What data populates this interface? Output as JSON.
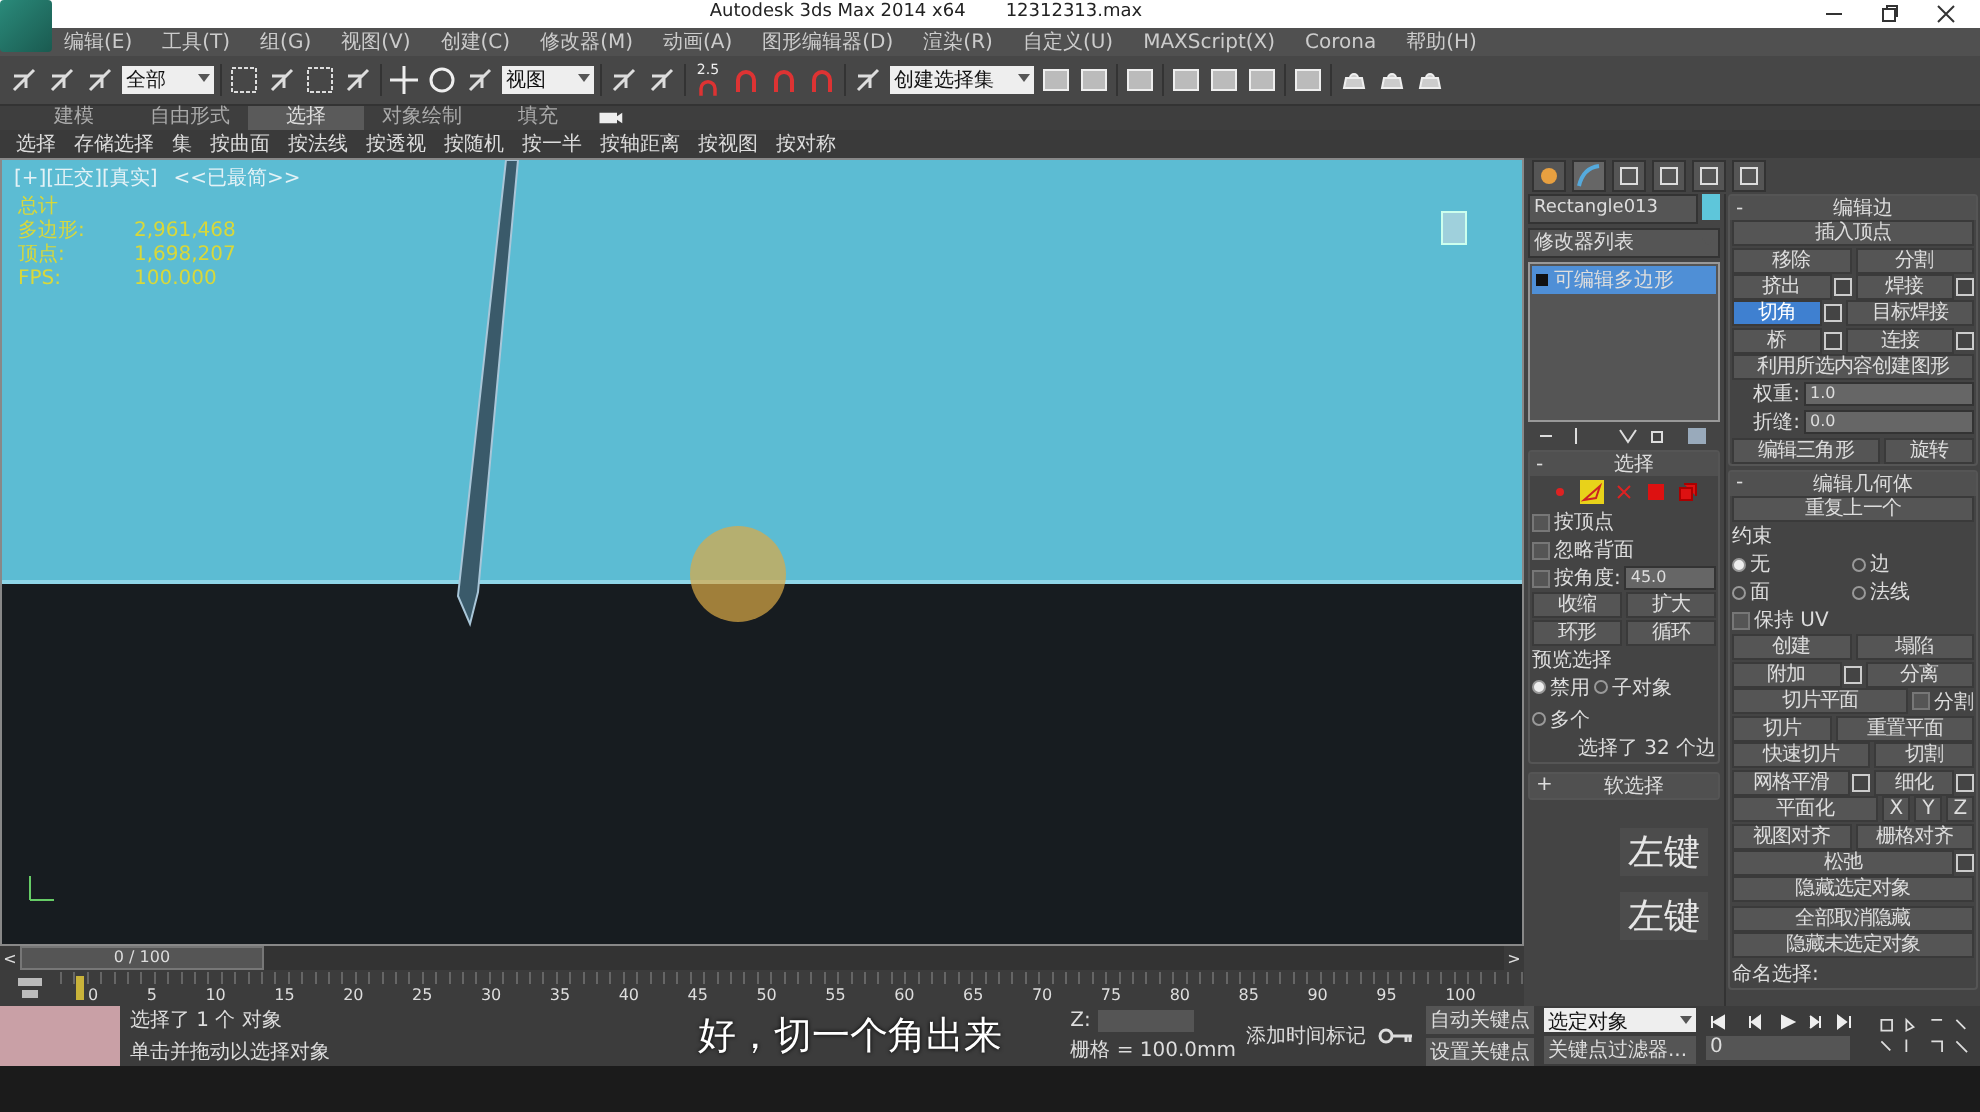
{
  "title_bar": {
    "app": "Autodesk 3ds Max  2014 x64",
    "file": "12312313.max"
  },
  "menu": [
    "编辑(E)",
    "工具(T)",
    "组(G)",
    "视图(V)",
    "创建(C)",
    "修改器(M)",
    "动画(A)",
    "图形编辑器(D)",
    "渲染(R)",
    "自定义(U)",
    "MAXScript(X)",
    "Corona",
    "帮助(H)"
  ],
  "toolbar": {
    "filter": "全部",
    "coord": "视图",
    "snap_value": "2.5",
    "selection_set": "创建选择集"
  },
  "ribbon_tabs": [
    {
      "label": "建模",
      "selected": false
    },
    {
      "label": "自由形式",
      "selected": false
    },
    {
      "label": "选择",
      "selected": true
    },
    {
      "label": "对象绘制",
      "selected": false
    },
    {
      "label": "填充",
      "selected": false
    }
  ],
  "ribbon_items": [
    "选择",
    "存储选择",
    "集",
    "按曲面",
    "按法线",
    "按透视",
    "按随机",
    "按一半",
    "按轴距离",
    "按视图",
    "按对称"
  ],
  "viewport": {
    "label": "[+][正交][真实]",
    "mode": "<<已最简>>",
    "stats": [
      {
        "label": "总计"
      },
      {
        "label": "多边形:",
        "value": "2,961,468"
      },
      {
        "label": "顶点:",
        "value": "1,698,207"
      },
      {
        "label": "FPS:",
        "value": "100.000"
      }
    ]
  },
  "modify": {
    "name": "Rectangle013",
    "modifier_list": "修改器列表",
    "stack": [
      {
        "label": "可编辑多边形",
        "selected": true
      }
    ],
    "subobjects": [
      {
        "selected": false
      },
      {
        "selected": true
      },
      {
        "selected": false
      },
      {
        "selected": false
      },
      {
        "selected": false
      }
    ],
    "left_rollouts": [
      {
        "toggle": "-",
        "title": "选择",
        "rows": [
          [
            {
              "kind": "check",
              "t": "按顶点",
              "checked": false
            }
          ],
          [
            {
              "kind": "check",
              "t": "忽略背面",
              "checked": false
            }
          ],
          [
            {
              "kind": "check",
              "t": "按角度:",
              "checked": false
            },
            {
              "kind": "spin",
              "t": "45.0"
            }
          ],
          [
            {
              "kind": "btn",
              "t": "收缩"
            },
            {
              "kind": "btn",
              "t": "扩大"
            }
          ],
          [
            {
              "kind": "btn",
              "t": "环形"
            },
            {
              "kind": "btn",
              "t": "循环"
            }
          ],
          [
            {
              "kind": "text",
              "t": "预览选择"
            }
          ],
          [
            {
              "kind": "radio",
              "t": "禁用",
              "selected": true
            },
            {
              "kind": "radio",
              "t": "子对象",
              "selected": false
            },
            {
              "kind": "radio",
              "t": "多个",
              "selected": false
            }
          ],
          [
            {
              "kind": "note",
              "t": "选择了 32 个边"
            }
          ]
        ]
      },
      {
        "toggle": "+",
        "title": "软选择"
      }
    ],
    "keys": [
      "左键",
      "左键"
    ],
    "right_rollouts": [
      {
        "toggle": "-",
        "title": "编辑边",
        "rows": [
          [
            {
              "kind": "btn",
              "t": "插入顶点"
            }
          ],
          [
            {
              "kind": "btn",
              "t": "移除"
            },
            {
              "kind": "btn",
              "t": "分割"
            }
          ],
          [
            {
              "kind": "btn",
              "t": "挤出",
              "opt": true
            },
            {
              "kind": "btn",
              "t": "焊接",
              "opt": true
            }
          ],
          [
            {
              "kind": "btn",
              "t": "切角",
              "opt": true,
              "active": true
            },
            {
              "kind": "btn",
              "t": "目标焊接"
            }
          ],
          [
            {
              "kind": "btn",
              "t": "桥",
              "opt": true
            },
            {
              "kind": "btn",
              "t": "连接",
              "opt": true
            }
          ],
          [
            {
              "kind": "btn",
              "t": "利用所选内容创建图形"
            }
          ],
          [
            {
              "kind": "label",
              "t": "权重:"
            },
            {
              "kind": "spin",
              "t": "1.0"
            }
          ],
          [
            {
              "kind": "label",
              "t": "折缝:"
            },
            {
              "kind": "spin",
              "t": "0.0"
            }
          ],
          [
            {
              "kind": "btn",
              "t": "编辑三角形"
            },
            {
              "kind": "btn",
              "t": "旋转"
            }
          ]
        ]
      },
      {
        "toggle": "-",
        "title": "编辑几何体",
        "rows": [
          [
            {
              "kind": "btn",
              "t": "重复上一个"
            }
          ],
          [
            {
              "kind": "text",
              "t": "约束"
            }
          ],
          [
            {
              "kind": "radio",
              "t": "无",
              "selected": true
            },
            {
              "kind": "radio",
              "t": "边",
              "selected": false
            }
          ],
          [
            {
              "kind": "radio",
              "t": "面",
              "selected": false
            },
            {
              "kind": "radio",
              "t": "法线",
              "selected": false
            }
          ],
          [
            {
              "kind": "check",
              "t": "保持 UV",
              "checked": false
            }
          ],
          [
            {
              "kind": "btn",
              "t": "创建"
            },
            {
              "kind": "btn",
              "t": "塌陷"
            }
          ],
          [
            {
              "kind": "btn",
              "t": "附加",
              "opt": true
            },
            {
              "kind": "btn",
              "t": "分离"
            }
          ],
          [
            {
              "kind": "btn",
              "t": "切片平面"
            },
            {
              "kind": "check",
              "t": "分割",
              "checked": false
            }
          ],
          [
            {
              "kind": "btn",
              "t": "切片"
            },
            {
              "kind": "btn",
              "t": "重置平面"
            }
          ],
          [
            {
              "kind": "btn",
              "t": "快速切片"
            },
            {
              "kind": "btn",
              "t": "切割"
            }
          ],
          [
            {
              "kind": "btn",
              "t": "网格平滑",
              "opt": true
            },
            {
              "kind": "btn",
              "t": "细化",
              "opt": true
            }
          ],
          [
            {
              "kind": "btn",
              "t": "平面化"
            },
            {
              "kind": "small",
              "t": "X"
            },
            {
              "kind": "small",
              "t": "Y"
            },
            {
              "kind": "small",
              "t": "Z"
            }
          ],
          [
            {
              "kind": "btn",
              "t": "视图对齐"
            },
            {
              "kind": "btn",
              "t": "栅格对齐"
            }
          ],
          [
            {
              "kind": "btn",
              "t": "松弛",
              "opt": true
            }
          ],
          [
            {
              "kind": "btn",
              "t": "隐藏选定对象"
            },
            {
              "kind": "btn",
              "t": "全部取消隐藏"
            }
          ],
          [
            {
              "kind": "btn",
              "t": "隐藏未选定对象"
            }
          ],
          [
            {
              "kind": "text",
              "t": "命名选择:"
            }
          ]
        ]
      }
    ]
  },
  "timeline": {
    "position": "0 / 100",
    "level": 0,
    "prev": "<",
    "next": ">",
    "ticks": [
      "0",
      "5",
      "10",
      "15",
      "20",
      "25",
      "30",
      "35",
      "40",
      "45",
      "50",
      "55",
      "60",
      "65",
      "70",
      "75",
      "80",
      "85",
      "90",
      "95",
      "100"
    ]
  },
  "status": {
    "selected": "选择了 1 个 对象",
    "prompt": "单击并拖动以选择对象",
    "z_label": "Z:",
    "grid": "栅格 = 100.0mm",
    "add_tag": "添加时间标记",
    "auto_key": "自动关键点",
    "key_mode": "选定对象",
    "set_key": "设置关键点",
    "key_filter": "关键点过滤器...",
    "frame": "0"
  },
  "subtitle": "好，切一个角出来"
}
